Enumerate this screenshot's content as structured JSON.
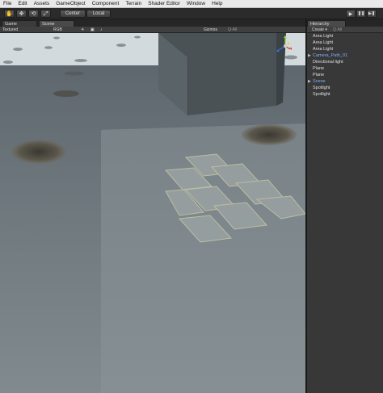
{
  "menubar": {
    "items": [
      "File",
      "Edit",
      "Assets",
      "GameObject",
      "Component",
      "Terrain",
      "Shader Editor",
      "Window",
      "Help"
    ]
  },
  "toolbar": {
    "tools": [
      {
        "name": "hand-tool",
        "glyph": "✋"
      },
      {
        "name": "move-tool",
        "glyph": "✥"
      },
      {
        "name": "rotate-tool",
        "glyph": "⟲"
      },
      {
        "name": "scale-tool",
        "glyph": "⤢"
      }
    ],
    "pivot_label": "Center",
    "space_label": "Local",
    "play_controls": [
      {
        "name": "play",
        "glyph": "▶"
      },
      {
        "name": "pause",
        "glyph": "❚❚"
      },
      {
        "name": "step",
        "glyph": "▶❚"
      }
    ]
  },
  "tabs": {
    "game_label": "Game",
    "scene_label": "Scene"
  },
  "scene_controls": {
    "draw_mode": "Textured",
    "render_mode": "RGB",
    "gizmos_label": "Gizmos",
    "search_label": "Q·All"
  },
  "hierarchy": {
    "tab_label": "Hierarchy",
    "create_label": "Create ▾",
    "search_label": "Q·All",
    "items": [
      {
        "label": "Area Light",
        "selected": false,
        "expandable": false
      },
      {
        "label": "Area Light",
        "selected": false,
        "expandable": false
      },
      {
        "label": "Area Light",
        "selected": false,
        "expandable": false
      },
      {
        "label": "Camera_Path_01",
        "selected": true,
        "expandable": true
      },
      {
        "label": "Directional light",
        "selected": false,
        "expandable": false
      },
      {
        "label": "Plane",
        "selected": false,
        "expandable": false
      },
      {
        "label": "Plane",
        "selected": false,
        "expandable": false
      },
      {
        "label": "Scene",
        "selected": true,
        "expandable": true
      },
      {
        "label": "Spotlight",
        "selected": false,
        "expandable": false
      },
      {
        "label": "Spotlight",
        "selected": false,
        "expandable": false
      }
    ]
  },
  "colors": {
    "selected_text": "#7fb0ff",
    "panel_bg": "#383838",
    "menubar_bg": "#e9e9e9"
  }
}
